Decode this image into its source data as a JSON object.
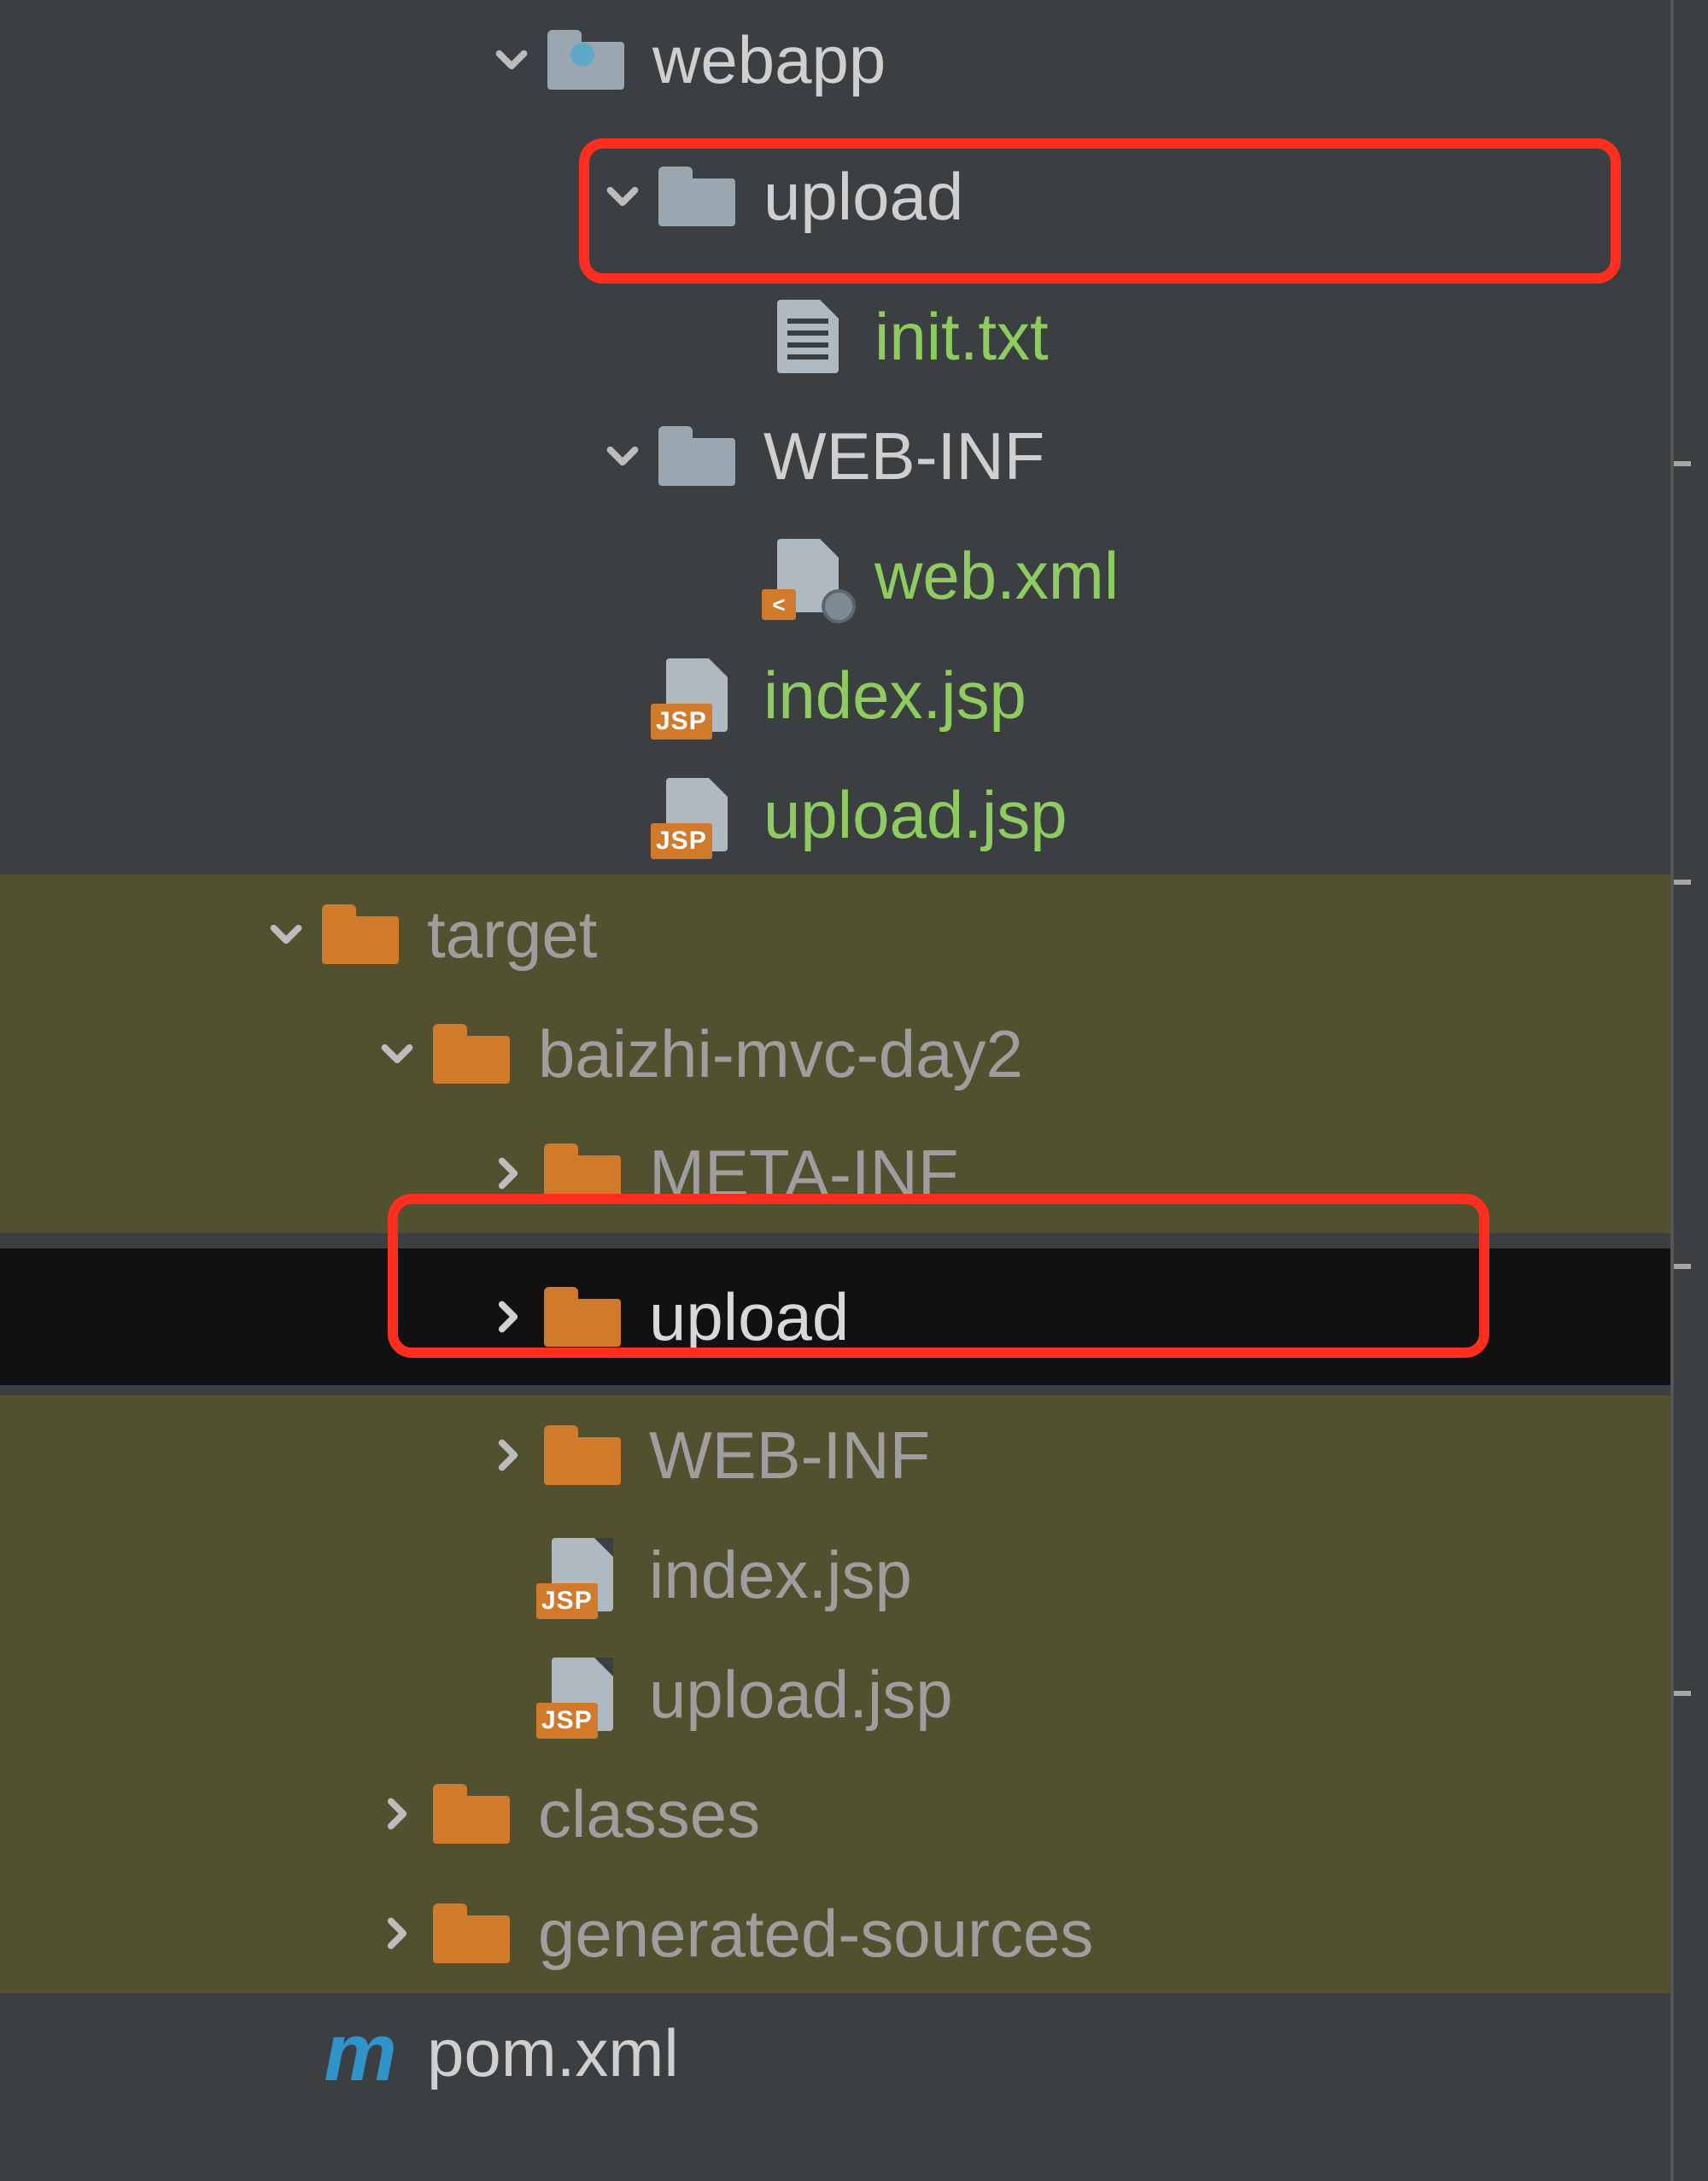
{
  "tree": {
    "webapp": "webapp",
    "upload1": "upload",
    "init_txt": "init.txt",
    "web_inf1": "WEB-INF",
    "web_xml": "web.xml",
    "index_jsp1": "index.jsp",
    "upload_jsp1": "upload.jsp",
    "target": "target",
    "project": "baizhi-mvc-day2",
    "meta_inf": "META-INF",
    "upload2": "upload",
    "web_inf2": "WEB-INF",
    "index_jsp2": "index.jsp",
    "upload_jsp2": "upload.jsp",
    "classes": "classes",
    "gensrc": "generated-sources",
    "pom": "pom.xml"
  },
  "badges": {
    "jsp": "JSP"
  }
}
